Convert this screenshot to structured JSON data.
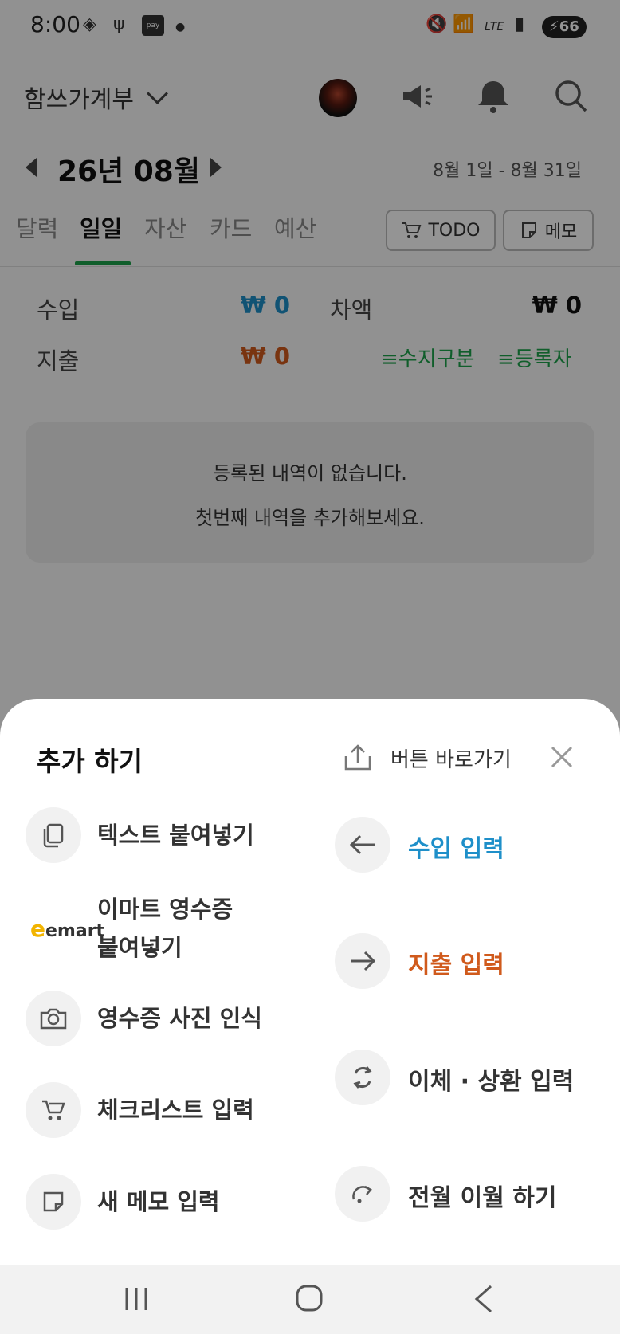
{
  "status_bar": {
    "time": "8:00",
    "pay_label": "pay",
    "battery": "66",
    "lte": "LTE"
  },
  "header": {
    "app_title": "함쓰가계부",
    "month": "26년 08월",
    "date_range": "8월 1일 - 8월 31일"
  },
  "tabs": [
    {
      "label": "달력"
    },
    {
      "label": "일일"
    },
    {
      "label": "자산"
    },
    {
      "label": "카드"
    },
    {
      "label": "예산"
    }
  ],
  "tab_buttons": {
    "todo": "TODO",
    "memo": "메모"
  },
  "summary": {
    "income_label": "수입",
    "income_value": "₩ 0",
    "balance_label": "차액",
    "balance_value": "₩ 0",
    "expense_label": "지출",
    "expense_value": "₩ 0",
    "filter_type": "수지구분",
    "filter_author": "등록자"
  },
  "empty_state": {
    "line1": "등록된 내역이 없습니다.",
    "line2": "첫번째 내역을 추가해보세요."
  },
  "sheet": {
    "title": "추가 하기",
    "shortcut_label": "버튼 바로가기",
    "left_items": [
      {
        "label": "텍스트 붙여넣기"
      },
      {
        "label_line1": "이마트 영수증",
        "label_line2": "붙여넣기",
        "logo": "emart"
      },
      {
        "label": "영수증 사진 인식"
      },
      {
        "label": "체크리스트 입력"
      },
      {
        "label": "새 메모 입력"
      }
    ],
    "right_items": [
      {
        "label": "수입 입력"
      },
      {
        "label": "지출 입력"
      },
      {
        "label": "이체 · 상환 입력"
      },
      {
        "label": "전월 이월 하기"
      }
    ]
  },
  "colors": {
    "income": "#1e8fc9",
    "expense": "#d05a1c",
    "accent_green": "#1da34a"
  },
  "icons": [
    "copy-icon",
    "camera-icon",
    "cart-icon",
    "memo-icon",
    "arrow-left-icon",
    "arrow-right-icon",
    "refresh-icon",
    "carry-over-icon",
    "share-upload-icon",
    "close-icon",
    "search-icon",
    "bell-icon",
    "megaphone-icon"
  ]
}
